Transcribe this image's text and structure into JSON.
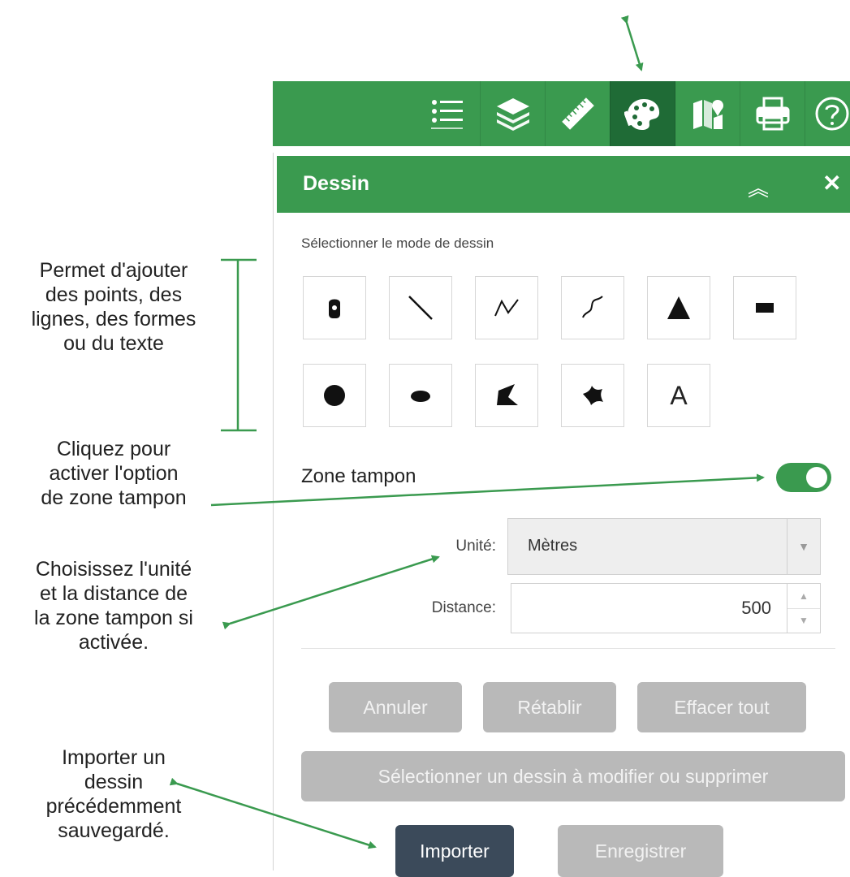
{
  "annotations": {
    "draw_modes": [
      "Permet d'ajouter",
      "des points, des",
      "lignes, des formes",
      "ou du texte"
    ],
    "buffer_toggle": [
      "Cliquez pour",
      "activer l'option",
      "de zone tampon"
    ],
    "buffer_settings": [
      "Choisissez l'unité",
      "et la distance de",
      "la zone tampon si",
      "activée."
    ],
    "import": [
      "Importer un",
      "dessin",
      "précédemment",
      "sauvegardé."
    ]
  },
  "toolbar": {
    "buttons": [
      {
        "icon": "legend-list-icon"
      },
      {
        "icon": "layers-icon"
      },
      {
        "icon": "measure-ruler-icon"
      },
      {
        "icon": "draw-palette-icon",
        "active": true
      },
      {
        "icon": "bookmarks-icon"
      },
      {
        "icon": "print-icon"
      },
      {
        "icon": "help-icon"
      }
    ]
  },
  "panel": {
    "title": "Dessin",
    "collapse_glyph": "︽",
    "close_glyph": "✕",
    "mode_label": "Sélectionner le mode de dessin",
    "modes": [
      {
        "name": "point"
      },
      {
        "name": "line"
      },
      {
        "name": "polyline"
      },
      {
        "name": "freehand-polyline"
      },
      {
        "name": "triangle"
      },
      {
        "name": "rectangle"
      },
      {
        "name": "circle"
      },
      {
        "name": "ellipse"
      },
      {
        "name": "polygon"
      },
      {
        "name": "freehand-polygon"
      },
      {
        "name": "text",
        "label": "A"
      }
    ],
    "buffer_label": "Zone tampon",
    "buffer_enabled": true,
    "unit_label": "Unité:",
    "unit_value": "Mètres",
    "distance_label": "Distance:",
    "distance_value": "500",
    "buttons": {
      "undo": "Annuler",
      "redo": "Rétablir",
      "clear": "Effacer tout",
      "select": "Sélectionner un dessin à modifier ou supprimer",
      "import": "Importer",
      "save": "Enregistrer"
    }
  },
  "colors": {
    "brand_green": "#3a9a4f",
    "active_dark_green": "#1f6b36",
    "import_button": "#3b4a5a",
    "disabled_button": "#b9b9b9",
    "arrow_green": "#3a9a4f"
  }
}
